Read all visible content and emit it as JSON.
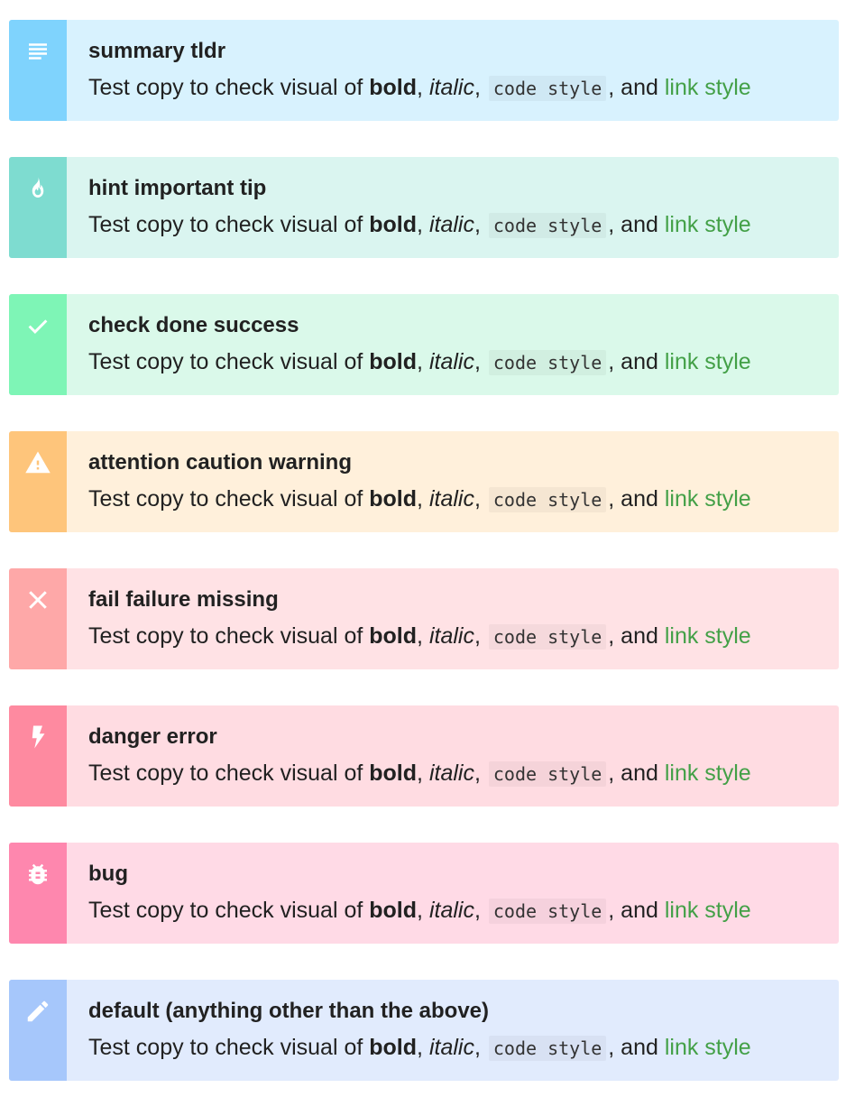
{
  "colors": {
    "link": "#43a047",
    "summary": {
      "bar": "#7fd3fd",
      "bg": "#d8f2fe"
    },
    "hint": {
      "bar": "#7edcd0",
      "bg": "#daf5f0"
    },
    "check": {
      "bar": "#7ef5b6",
      "bg": "#daf9ea"
    },
    "attention": {
      "bar": "#fec57b",
      "bg": "#fff0db"
    },
    "fail": {
      "bar": "#fea8a8",
      "bg": "#ffe2e5"
    },
    "danger": {
      "bar": "#fe8aa0",
      "bg": "#ffdce2"
    },
    "bug": {
      "bar": "#fe87ae",
      "bg": "#ffdae6"
    },
    "default": {
      "bar": "#a6c7fb",
      "bg": "#e1ebfd"
    }
  },
  "callouts": [
    {
      "type": "summary",
      "icon": "lines-icon",
      "title": "summary tldr",
      "text_prefix": "Test copy to check visual of",
      "bold": "bold",
      "sep1": ",",
      "italic": "italic",
      "sep2": ",",
      "code": "code style",
      "and": ", and",
      "link": "link style"
    },
    {
      "type": "hint",
      "icon": "flame-icon",
      "title": "hint important tip",
      "text_prefix": "Test copy to check visual of",
      "bold": "bold",
      "sep1": ",",
      "italic": "italic",
      "sep2": ",",
      "code": "code style",
      "and": ", and",
      "link": "link style"
    },
    {
      "type": "check",
      "icon": "checkmark-icon",
      "title": "check done success",
      "text_prefix": "Test copy to check visual of",
      "bold": "bold",
      "sep1": ",",
      "italic": "italic",
      "sep2": ",",
      "code": "code style",
      "and": ", and",
      "link": "link style"
    },
    {
      "type": "attention",
      "icon": "warning-triangle-icon",
      "title": "attention caution warning",
      "text_prefix": "Test copy to check visual of",
      "bold": "bold",
      "sep1": ",",
      "italic": "italic",
      "sep2": ",",
      "code": "code style",
      "and": ", and",
      "link": "link style"
    },
    {
      "type": "fail",
      "icon": "close-x-icon",
      "title": "fail failure missing",
      "text_prefix": "Test copy to check visual of",
      "bold": "bold",
      "sep1": ",",
      "italic": "italic",
      "sep2": ",",
      "code": "code style",
      "and": ", and",
      "link": "link style"
    },
    {
      "type": "danger",
      "icon": "lightning-bolt-icon",
      "title": "danger error",
      "text_prefix": "Test copy to check visual of",
      "bold": "bold",
      "sep1": ",",
      "italic": "italic",
      "sep2": ",",
      "code": "code style",
      "and": ", and",
      "link": "link style"
    },
    {
      "type": "bug",
      "icon": "bug-icon",
      "title": "bug",
      "text_prefix": "Test copy to check visual of",
      "bold": "bold",
      "sep1": ",",
      "italic": "italic",
      "sep2": ",",
      "code": "code style",
      "and": ", and",
      "link": "link style"
    },
    {
      "type": "default",
      "icon": "pencil-icon",
      "title": "default (anything other than the above)",
      "text_prefix": "Test copy to check visual of",
      "bold": "bold",
      "sep1": ",",
      "italic": "italic",
      "sep2": ",",
      "code": "code style",
      "and": ", and",
      "link": "link style"
    }
  ]
}
